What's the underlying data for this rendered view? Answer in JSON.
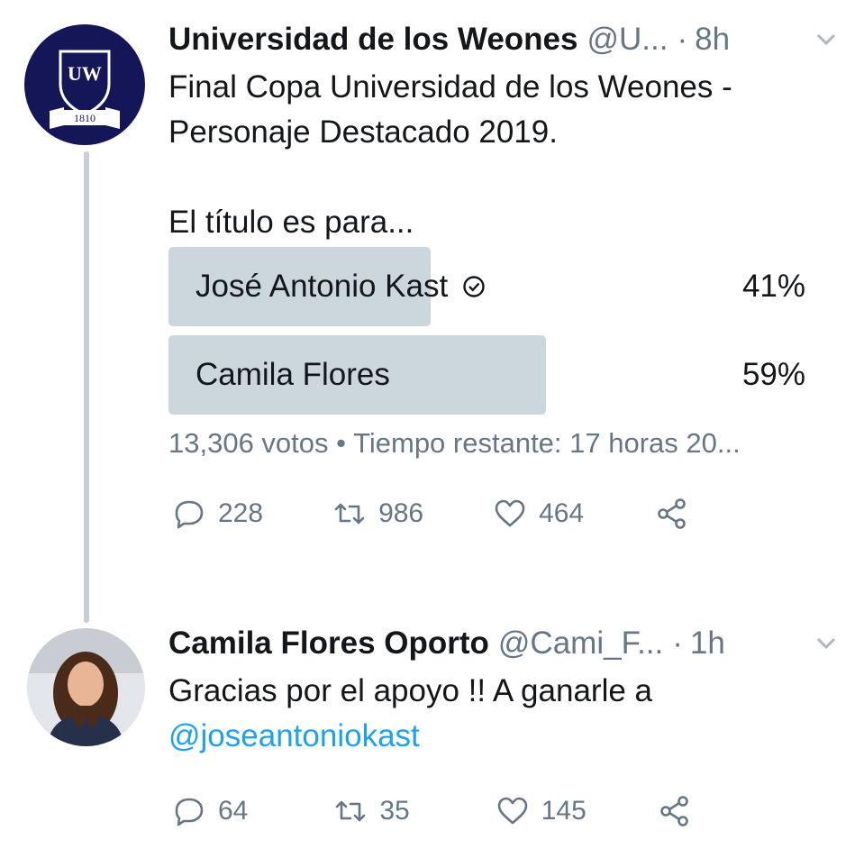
{
  "colors": {
    "mention": "#1da1f2",
    "secondary_text": "#657786",
    "poll_fill": "#ccd6dd",
    "avatar_bg": "#141658",
    "thread_line": "#c4cfd6"
  },
  "tweet1": {
    "author_name": "Universidad de los Weones",
    "handle": "@U...",
    "separator": "·",
    "time": "8h",
    "text_line1": "Final Copa Universidad de los Weones -",
    "text_line2": "Personaje Destacado 2019.",
    "text_line3": "El título es para...",
    "avatar_logo": {
      "letters": "UW",
      "year": "1810"
    },
    "poll": {
      "options": [
        {
          "label": "José Antonio Kast",
          "percent_text": "41%",
          "fraction": 0.41
        },
        {
          "label": "Camila Flores",
          "percent_text": "59%",
          "fraction": 0.59
        }
      ],
      "votes": "13,306 votos",
      "bullet": "•",
      "time_left": "Tiempo restante: 17 horas 20..."
    },
    "stats": {
      "replies": "228",
      "retweets": "986",
      "likes": "464"
    }
  },
  "tweet2": {
    "author_name": "Camila Flores Oporto",
    "handle": "@Cami_F...",
    "separator": "·",
    "time": "1h",
    "text_line1": "Gracias por el apoyo !! A ganarle a",
    "mention": "@joseantoniokast",
    "stats": {
      "replies": "64",
      "retweets": "35",
      "likes": "145"
    }
  }
}
